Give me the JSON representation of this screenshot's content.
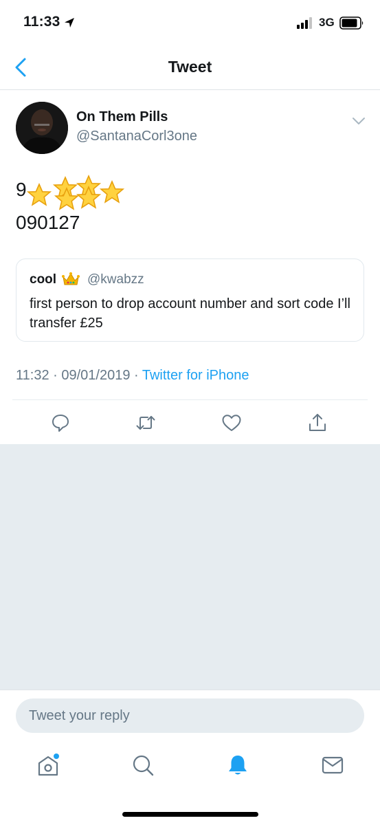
{
  "status_bar": {
    "time": "11:33",
    "network": "3G"
  },
  "nav": {
    "title": "Tweet"
  },
  "tweet": {
    "author_name": "On Them Pills",
    "author_handle": "@SantanaCorl3one",
    "text_line1": "9",
    "text_line2": "090127",
    "timestamp": "11:32 · 09/01/2019 · ",
    "source": "Twitter for iPhone"
  },
  "quote": {
    "name": "cool",
    "handle": "@kwabzz",
    "text": "first person to drop account number and sort code I’ll transfer £25"
  },
  "reply": {
    "placeholder": "Tweet your reply"
  },
  "colors": {
    "accent": "#1da1f2",
    "muted": "#657786",
    "background_grey": "#e6ecf0"
  },
  "icons": {
    "actions": [
      "reply-icon",
      "retweet-icon",
      "like-icon",
      "share-icon"
    ],
    "tabs": [
      "home-icon",
      "search-icon",
      "notifications-icon",
      "messages-icon"
    ]
  }
}
